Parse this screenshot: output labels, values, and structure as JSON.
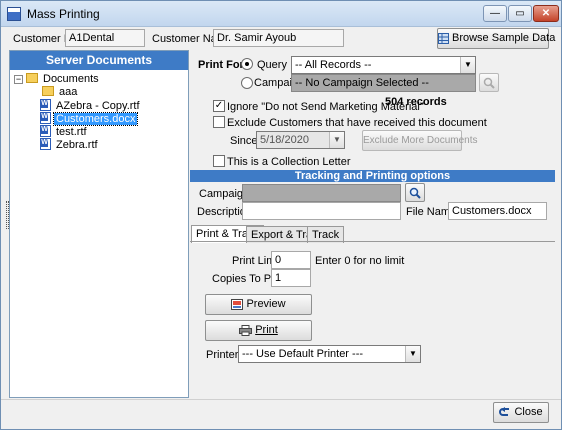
{
  "window": {
    "title": "Mass Printing",
    "buttons": {
      "minimize": "—",
      "maximize": "▭",
      "close": "✕"
    }
  },
  "customer": {
    "id_label": "Customer ID:",
    "id_value": "A1Dental",
    "name_label": "Customer Name:",
    "name_value": "Dr. Samir Ayoub",
    "browse_label": "Browse Sample Data"
  },
  "server_documents": {
    "header": "Server Documents",
    "tree": [
      {
        "label": "Documents",
        "kind": "folder",
        "expander": "−"
      },
      {
        "label": "aaa",
        "kind": "folder"
      },
      {
        "label": "AZebra - Copy.rtf",
        "kind": "doc"
      },
      {
        "label": "Customers.docx",
        "kind": "doc",
        "selected": true
      },
      {
        "label": "test.rtf",
        "kind": "doc"
      },
      {
        "label": "Zebra.rtf",
        "kind": "doc"
      }
    ]
  },
  "print_for": {
    "label": "Print For:",
    "query_label": "Query",
    "query_selected": true,
    "query_value": "-- All Records --",
    "campaign_label": "Campaign",
    "campaign_value": "-- No Campaign Selected --",
    "records": "504 records",
    "ignore_label": "Ignore \"Do not Send Marketing Material\"",
    "ignore_checked": true,
    "exclude_label": "Exclude Customers that have received this document",
    "exclude_checked": false,
    "since_label": "Since:",
    "since_value": "5/18/2020",
    "exclude_more_label": "Exclude More Documents",
    "collection_label": "This is a Collection Letter",
    "collection_checked": false
  },
  "tracking": {
    "header": "Tracking and Printing options",
    "campaign_label": "Campaign:",
    "campaign_value": "",
    "description_label": "Description:",
    "description_value": "",
    "filename_label": "File Name:",
    "filename_value": "Customers.docx"
  },
  "tabs": [
    {
      "label": "Print & Track",
      "active": true
    },
    {
      "label": "Export & Track",
      "active": false
    },
    {
      "label": "Track",
      "active": false
    }
  ],
  "print_track": {
    "print_limit_label": "Print Limit:",
    "print_limit_value": "0",
    "print_limit_hint": "Enter 0 for no limit",
    "copies_label": "Copies To Print:",
    "copies_value": "1",
    "preview_label": "Preview",
    "print_label": "Print",
    "printer_label": "Printer:",
    "printer_value": "--- Use Default Printer ---"
  },
  "footer": {
    "close_label": "Close"
  },
  "colors": {
    "header_blue": "#3e7bc6",
    "selection": "#3399ff"
  },
  "icons": [
    "app-icon",
    "grid-icon",
    "magnifier-icon",
    "preview-icon",
    "printer-icon",
    "close-arrow-icon",
    "folder-icon",
    "word-doc-icon",
    "dropdown-arrow-icon"
  ]
}
